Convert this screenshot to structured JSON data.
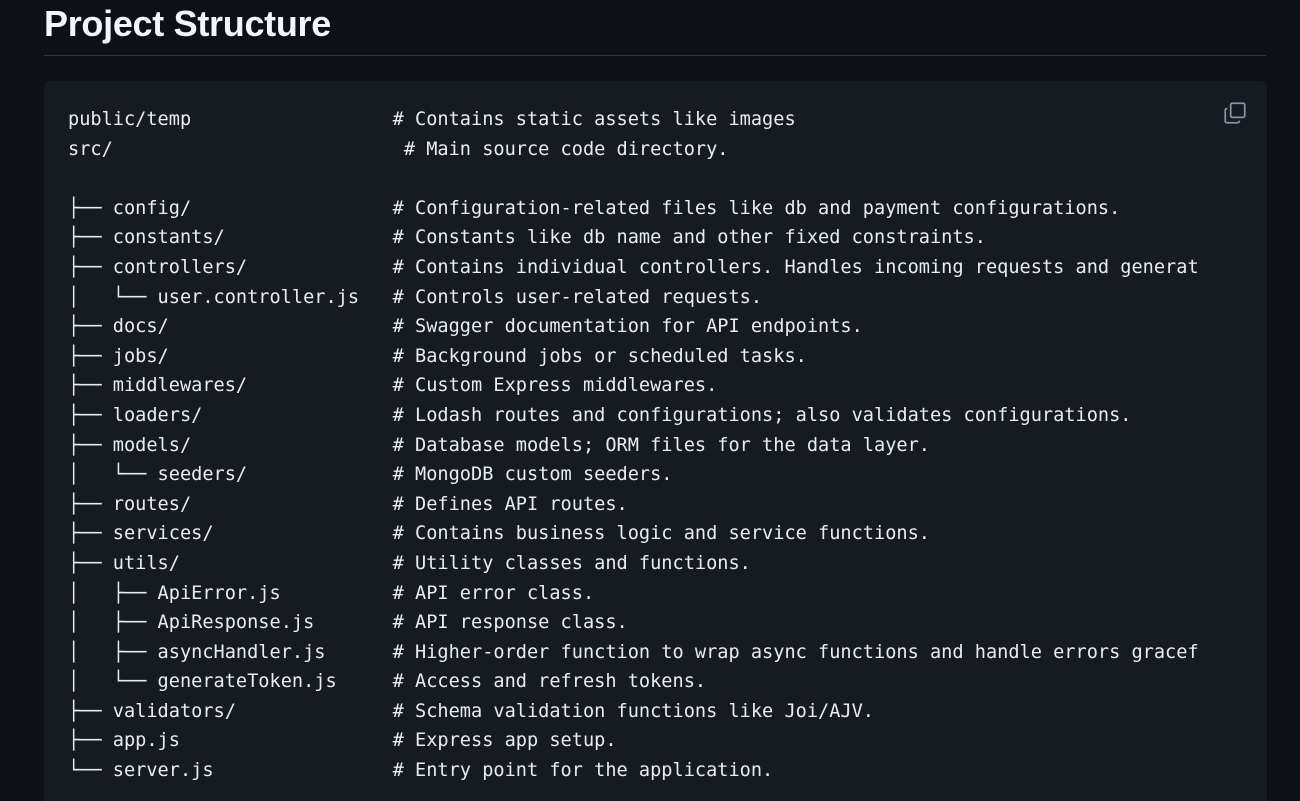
{
  "heading": "Project Structure",
  "code_lines": [
    "public/temp                  # Contains static assets like images",
    "src/                          # Main source code directory.",
    "",
    "├── config/                  # Configuration-related files like db and payment configurations.",
    "├── constants/               # Constants like db name and other fixed constraints.",
    "├── controllers/             # Contains individual controllers. Handles incoming requests and generat",
    "│   └── user.controller.js   # Controls user-related requests.",
    "├── docs/                    # Swagger documentation for API endpoints.",
    "├── jobs/                    # Background jobs or scheduled tasks.",
    "├── middlewares/             # Custom Express middlewares.",
    "├── loaders/                 # Lodash routes and configurations; also validates configurations.",
    "├── models/                  # Database models; ORM files for the data layer.",
    "│   └── seeders/             # MongoDB custom seeders.",
    "├── routes/                  # Defines API routes.",
    "├── services/                # Contains business logic and service functions.",
    "├── utils/                   # Utility classes and functions.",
    "│   ├── ApiError.js          # API error class.",
    "│   ├── ApiResponse.js       # API response class.",
    "│   ├── asyncHandler.js      # Higher-order function to wrap async functions and handle errors gracef",
    "│   └── generateToken.js     # Access and refresh tokens.",
    "├── validators/              # Schema validation functions like Joi/AJV.",
    "├── app.js                   # Express app setup.",
    "└── server.js                # Entry point for the application."
  ],
  "copy_icon": "copy-icon"
}
